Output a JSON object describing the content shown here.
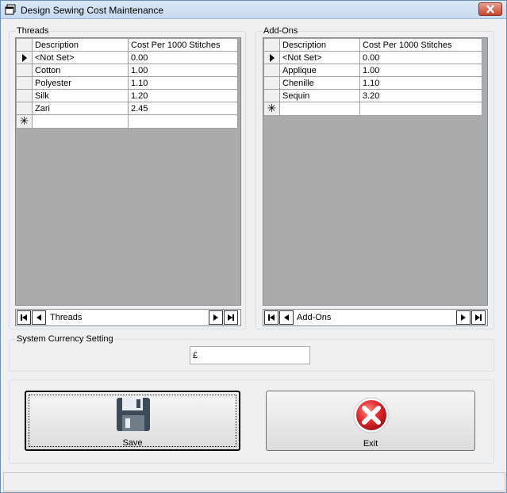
{
  "window": {
    "title": "Design Sewing Cost Maintenance"
  },
  "threads": {
    "group_label": "Threads",
    "columns": [
      "Description",
      "Cost Per 1000 Stitches"
    ],
    "rows": [
      {
        "description": "<Not Set>",
        "cost": "0.00",
        "current": true
      },
      {
        "description": "Cotton",
        "cost": "1.00",
        "current": false
      },
      {
        "description": "Polyester",
        "cost": "1.10",
        "current": false
      },
      {
        "description": "Silk",
        "cost": "1.20",
        "current": false
      },
      {
        "description": "Zari",
        "cost": "2.45",
        "current": false
      }
    ],
    "navigator_label": "Threads"
  },
  "addons": {
    "group_label": "Add-Ons",
    "columns": [
      "Description",
      "Cost Per 1000 Stitches"
    ],
    "rows": [
      {
        "description": "<Not Set>",
        "cost": "0.00",
        "current": true
      },
      {
        "description": "Applique",
        "cost": "1.00",
        "current": false
      },
      {
        "description": "Chenille",
        "cost": "1.10",
        "current": false
      },
      {
        "description": "Sequin",
        "cost": "3.20",
        "current": false
      }
    ],
    "navigator_label": "Add-Ons"
  },
  "currency": {
    "group_label": "System Currency Setting",
    "value": "£"
  },
  "actions": {
    "save_label": "Save",
    "exit_label": "Exit",
    "save_icon": "floppy-disk-icon",
    "exit_icon": "exit-x-icon"
  },
  "colors": {
    "titlebar": "#c7daef",
    "exit_red": "#e3262b",
    "window_bg": "#f0f0f0"
  }
}
